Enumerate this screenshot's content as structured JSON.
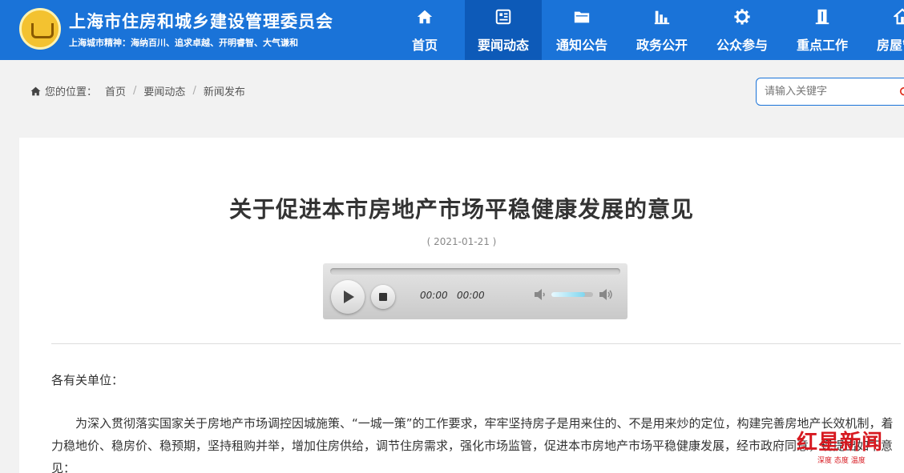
{
  "header": {
    "site_title": "上海市住房和城乡建设管理委员会",
    "slogan": "上海城市精神：海纳百川、追求卓越、开明睿智、大气谦和",
    "nav": [
      {
        "label": "首页",
        "icon": "home-icon"
      },
      {
        "label": "要闻动态",
        "icon": "news-icon",
        "active": true
      },
      {
        "label": "通知公告",
        "icon": "folder-icon"
      },
      {
        "label": "政务公开",
        "icon": "bar-chart-icon"
      },
      {
        "label": "公众参与",
        "icon": "gear-icon"
      },
      {
        "label": "重点工作",
        "icon": "building-icon"
      },
      {
        "label": "房屋管理",
        "icon": "house-icon"
      }
    ]
  },
  "breadcrumb": {
    "prefix": "您的位置：",
    "items": [
      "首页",
      "要闻动态",
      "新闻发布"
    ]
  },
  "search": {
    "placeholder": "请输入关键字"
  },
  "article": {
    "title": "关于促进本市房地产市场平稳健康发展的意见",
    "date": "( 2021-01-21 )",
    "greeting": "各有关单位：",
    "paragraph": "为深入贯彻落实国家关于房地产市场调控因城施策、“一城一策”的工作要求，牢牢坚持房子是用来住的、不是用来炒的定位，构建完善房地产长效机制，着力稳地价、稳房价、稳预期，坚持租购并举，增加住房供给，调节住房需求，强化市场监管，促进本市房地产市场平稳健康发展，经市政府同意，现提出如下意见："
  },
  "player": {
    "current_time": "00:00",
    "total_time": "00:00",
    "progress": 0,
    "volume": 0.8
  },
  "watermark": {
    "brand": "红星新闻",
    "tagline": "深度 态度 温度"
  },
  "colors": {
    "header_bg": "#1a73d8",
    "nav_active_bg": "#0d5ab8",
    "watermark_red": "#d71920"
  }
}
